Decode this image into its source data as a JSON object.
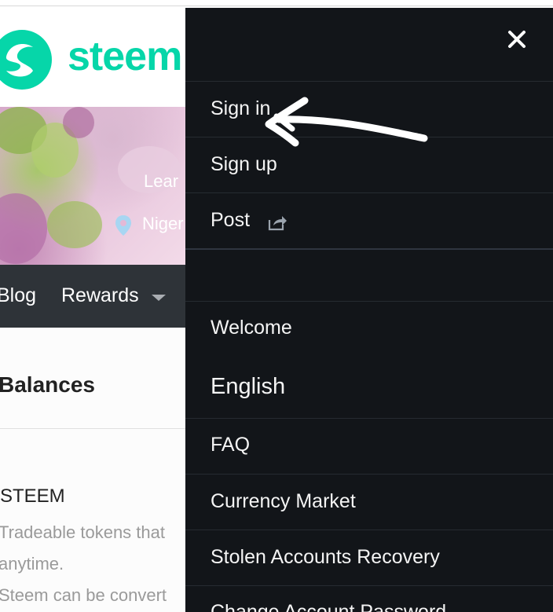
{
  "header": {
    "logo_text": "steem",
    "brand_color": "#06d6a9"
  },
  "banner": {
    "line_2": "Lear",
    "location": "Niger"
  },
  "navbar": {
    "blog_label": "Blog",
    "rewards_label": "Rewards"
  },
  "wallet": {
    "balances_title": "Balances",
    "steem_label": "STEEM",
    "steem_description_lines": [
      "Tradeable tokens that",
      "anytime.",
      "Steem can be convert"
    ]
  },
  "side_menu": {
    "close_icon": "close-icon",
    "items": [
      {
        "label": "Sign in"
      },
      {
        "label": "Sign up"
      },
      {
        "label": "Post"
      },
      {
        "label": "Welcome"
      },
      {
        "label": "English"
      },
      {
        "label": "FAQ"
      },
      {
        "label": "Currency Market"
      },
      {
        "label": "Stolen Accounts Recovery"
      },
      {
        "label": "Change Account Password"
      }
    ]
  },
  "colors": {
    "menu_background": "#121519",
    "navbar_background": "#2e3338",
    "menu_text": "#f4f4f4"
  }
}
